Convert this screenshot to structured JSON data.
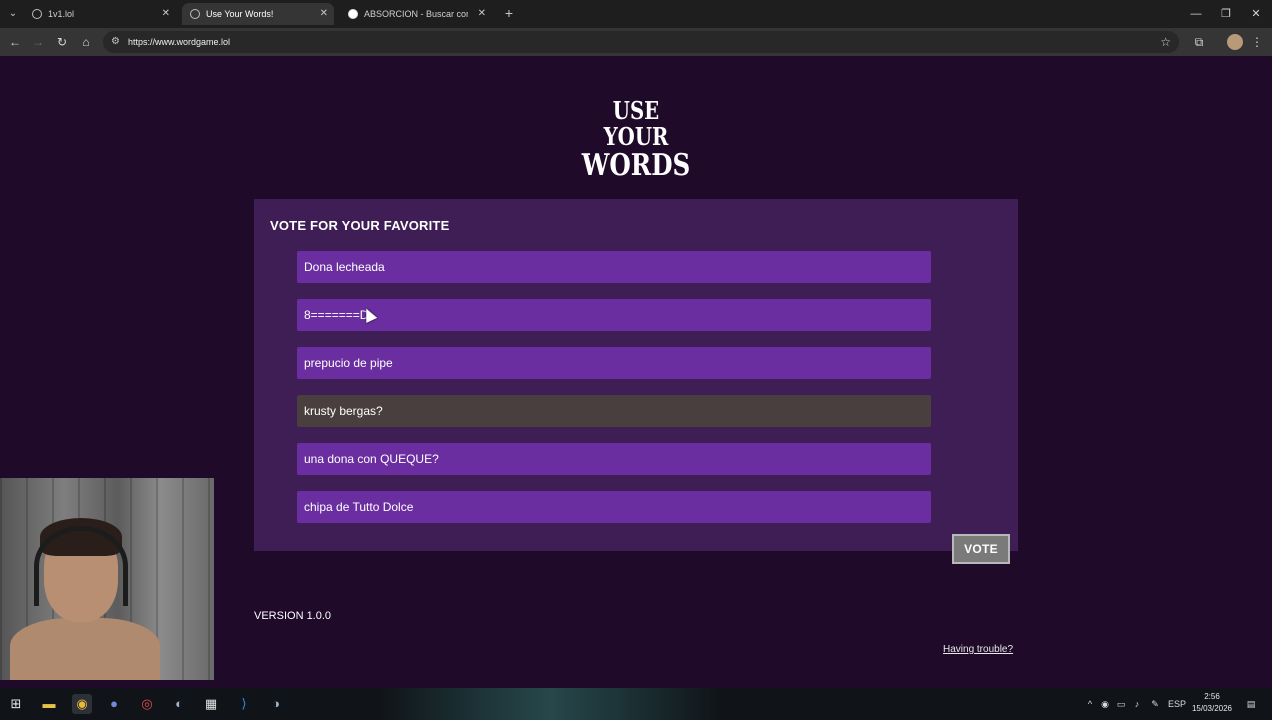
{
  "browser": {
    "tabs": [
      {
        "title": "1v1.lol",
        "icon": "globe-icon",
        "active": false
      },
      {
        "title": "Use Your Words!",
        "icon": "globe-icon",
        "active": true
      },
      {
        "title": "ABSORCION - Buscar con Goog",
        "icon": "google-icon",
        "active": false
      }
    ],
    "url": "https://www.wordgame.lol"
  },
  "page": {
    "logo_line1": "USE YOUR",
    "logo_line2": "WORDS",
    "heading": "VOTE FOR YOUR FAVORITE",
    "options": [
      {
        "text": "Dona lecheada",
        "selected": false
      },
      {
        "text": "8=======D",
        "selected": false
      },
      {
        "text": "prepucio de pipe",
        "selected": false
      },
      {
        "text": "krusty bergas?",
        "selected": true
      },
      {
        "text": "una dona con QUEQUE?",
        "selected": false
      },
      {
        "text": "chipa de Tutto Dolce",
        "selected": false
      }
    ],
    "vote_label": "VOTE",
    "version": "VERSION 1.0.0",
    "trouble_link": "Having trouble?"
  },
  "colors": {
    "page_bg": "#1f0a2a",
    "panel_bg": "#3f1d55",
    "option_bg": "#6b2ea0",
    "option_selected_bg": "#4a3f3f",
    "vote_bg": "#7a7a7a"
  },
  "taskbar": {
    "tray_language": "ESP",
    "time": "2:56",
    "date": "15/03/2026"
  }
}
